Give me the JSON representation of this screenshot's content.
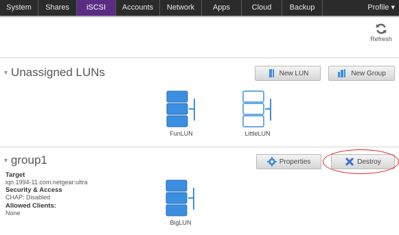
{
  "nav": {
    "tabs": [
      {
        "label": "System"
      },
      {
        "label": "Shares"
      },
      {
        "label": "iSCSI"
      },
      {
        "label": "Accounts"
      },
      {
        "label": "Network"
      },
      {
        "label": "Apps"
      },
      {
        "label": "Cloud"
      },
      {
        "label": "Backup"
      },
      {
        "label": "Profile ▾"
      }
    ],
    "active_tab": "iSCSI"
  },
  "toolbar": {
    "refresh_label": "Refresh"
  },
  "unassigned": {
    "title": "Unassigned LUNs",
    "new_lun_label": "New LUN",
    "new_group_label": "New Group",
    "luns": [
      {
        "name": "FunLUN",
        "state": "filled"
      },
      {
        "name": "LittleLUN",
        "state": "empty"
      }
    ]
  },
  "group": {
    "title": "group1",
    "properties_label": "Properties",
    "destroy_label": "Destroy",
    "target_label": "Target",
    "target_value": "iqn.1994-11.com.netgear:ultra",
    "security_label": "Security & Access",
    "security_value": "CHAP: Disabled",
    "clients_label": "Allowed Clients:",
    "clients_value": "None",
    "luns": [
      {
        "name": "BigLUN",
        "state": "filled"
      }
    ]
  },
  "colors": {
    "nav_bg": "#2b2b2b",
    "nav_active": "#5b2c83",
    "lun_blue": "#3b8ee0",
    "annotation_red": "#e02020"
  }
}
